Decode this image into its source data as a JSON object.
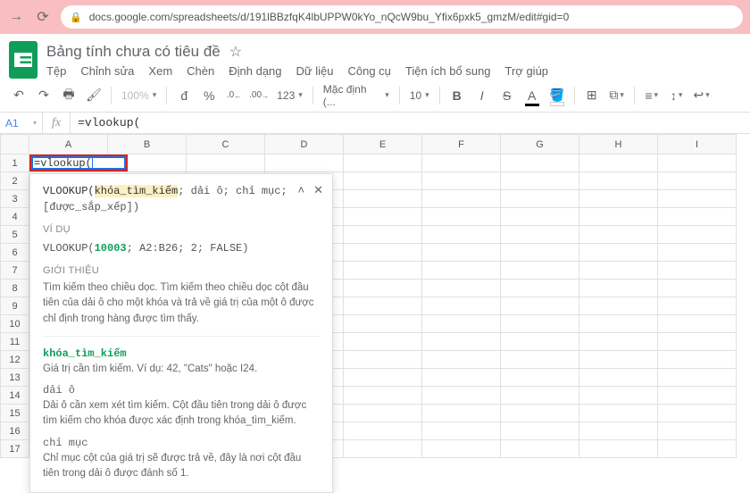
{
  "browser": {
    "url": "docs.google.com/spreadsheets/d/191lBBzfqK4lbUPPW0kYo_nQcW9bu_Yfix6pxk5_gmzM/edit#gid=0"
  },
  "doc": {
    "title": "Bảng tính chưa có tiêu đề"
  },
  "menu": {
    "file": "Tệp",
    "edit": "Chỉnh sửa",
    "view": "Xem",
    "insert": "Chèn",
    "format": "Định dạng",
    "data": "Dữ liệu",
    "tools": "Công cụ",
    "addons": "Tiện ích bổ sung",
    "help": "Trợ giúp"
  },
  "toolbar": {
    "zoom": "100%",
    "currency": "đ",
    "percent": "%",
    "dec_dec": ".0",
    "inc_dec": ".00",
    "more_fmt": "123",
    "font": "Mặc định (...",
    "size": "10",
    "bold": "B",
    "italic": "I",
    "strike": "S",
    "textcolor": "A"
  },
  "namebox": "A1",
  "formula": "=vlookup(",
  "active_cell_text": "=vlookup(",
  "columns": [
    "A",
    "B",
    "C",
    "D",
    "E",
    "F",
    "G",
    "H",
    "I"
  ],
  "rows": [
    "1",
    "2",
    "3",
    "4",
    "5",
    "6",
    "7",
    "8",
    "9",
    "10",
    "11",
    "12",
    "13",
    "14",
    "15",
    "16",
    "17"
  ],
  "helper": {
    "sig_fn": "VLOOKUP(",
    "sig_arg1": "khóa_tìm_kiếm",
    "sig_rest": "; dải ô; chỉ mục; [được_sắp_xếp])",
    "example_title": "VÍ DỤ",
    "example_fn": "VLOOKUP(",
    "example_num": "10003",
    "example_rest": "; A2:B26; 2; FALSE)",
    "about_title": "GIỚI THIỆU",
    "about_text": "Tìm kiếm theo chiều dọc. Tìm kiếm theo chiều dọc cột đầu tiên của dải ô cho một khóa và trả về giá trị của một ô được chỉ định trong hàng được tìm thấy.",
    "p1_name": "khóa_tìm_kiếm",
    "p1_desc": "Giá trị cần tìm kiếm. Ví dụ: 42, \"Cats\" hoặc I24.",
    "p2_name": "dải ô",
    "p2_desc": "Dải ô cần xem xét tìm kiếm. Cột đầu tiên trong dải ô được tìm kiếm cho khóa được xác định trong khóa_tìm_kiếm.",
    "p3_name": "chỉ mục",
    "p3_desc": "Chỉ mục cột của giá trị sẽ được trả về, đây là nơi cột đầu tiên trong dải ô được đánh số 1."
  }
}
